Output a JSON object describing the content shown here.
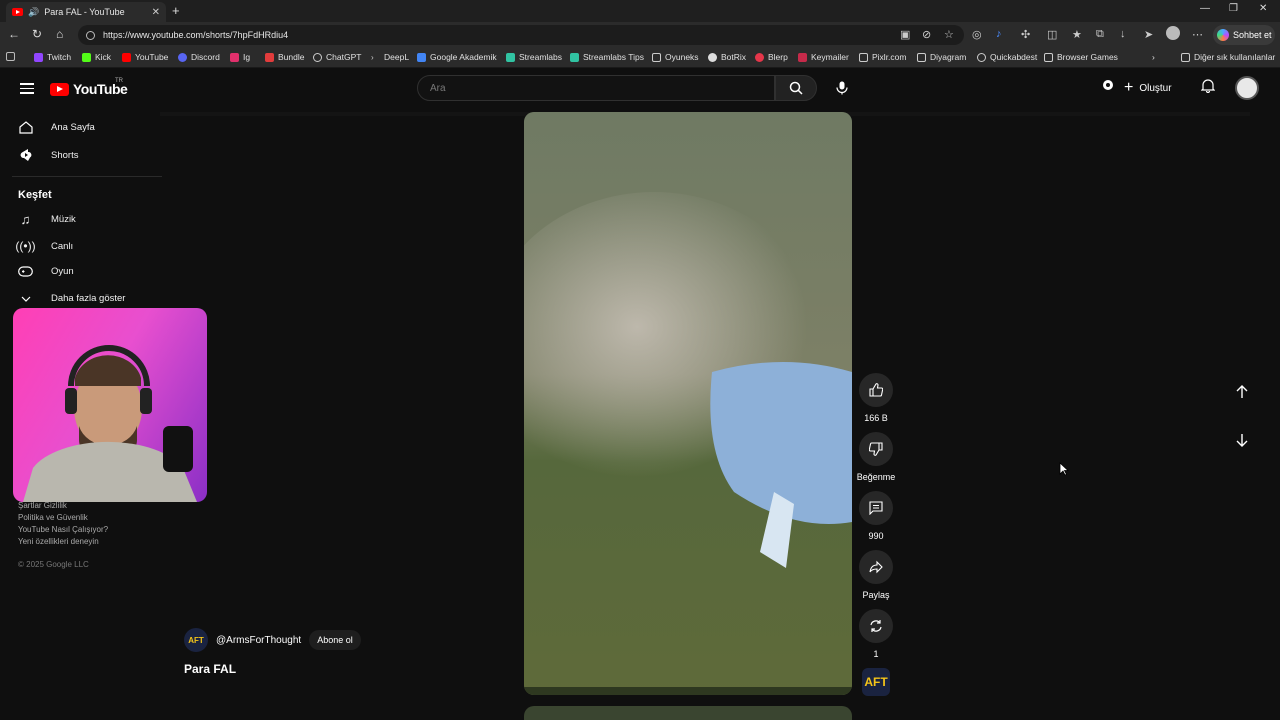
{
  "browser": {
    "tab": {
      "title": "Para FAL - YouTube"
    },
    "url": "https://www.youtube.com/shorts/7hpFdHRdiu4",
    "copilot_label": "Sohbet et",
    "bookmarks": [
      "Twitch",
      "Kick",
      "YouTube",
      "Discord",
      "Ig",
      "Bundle",
      "ChatGPT",
      "DeepL",
      "Google Akademik",
      "Streamlabs",
      "Streamlabs Tips",
      "Oyuneks",
      "BotRix",
      "Blerp",
      "Keymailer",
      "Pixlr.com",
      "Diyagram",
      "Quickabdest",
      "Browser Games"
    ],
    "other_bookmarks": "Diğer sık kullanılanlar"
  },
  "youtube": {
    "logo_text": "YouTube",
    "country_code": "TR",
    "search_placeholder": "Ara",
    "create_label": "Oluştur"
  },
  "sidebar": {
    "home": "Ana Sayfa",
    "shorts": "Shorts",
    "explore_heading": "Keşfet",
    "music": "Müzik",
    "live": "Canlı",
    "gaming": "Oyun",
    "show_more": "Daha fazla göster",
    "footer": {
      "terms_privacy": "Şartlar  Gizlilik",
      "policy": "Politika ve Güvenlik",
      "how_works": "YouTube Nasıl Çalışıyor?",
      "new_features": "Yeni özellikleri deneyin",
      "copyright": "© 2025 Google LLC"
    }
  },
  "short": {
    "channel_handle": "@ArmsForThought",
    "channel_badge": "AFT",
    "subscribe_label": "Abone ol",
    "title": "Para FAL",
    "likes": "166 B",
    "dislike_label": "Beğenme",
    "comments": "990",
    "share_label": "Paylaş",
    "remix_count": "1"
  }
}
